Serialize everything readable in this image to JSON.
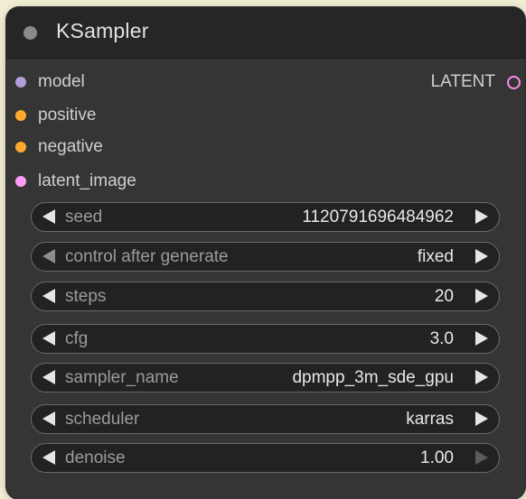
{
  "node": {
    "title": "KSampler",
    "inputs": [
      {
        "label": "model",
        "color": "#b39ddb"
      },
      {
        "label": "positive",
        "color": "#ffa931"
      },
      {
        "label": "negative",
        "color": "#ffa931"
      },
      {
        "label": "latent_image",
        "color": "#ff9cf9"
      }
    ],
    "output": {
      "label": "LATENT",
      "color": "#ff9cf9"
    },
    "widgets": [
      {
        "label": "seed",
        "value": "1120791696484962"
      },
      {
        "label": "control after generate",
        "value": "fixed"
      },
      {
        "label": "steps",
        "value": "20"
      },
      {
        "label": "cfg",
        "value": "3.0"
      },
      {
        "label": "sampler_name",
        "value": "dpmpp_3m_sde_gpu"
      },
      {
        "label": "scheduler",
        "value": "karras"
      },
      {
        "label": "denoise",
        "value": "1.00"
      }
    ]
  }
}
